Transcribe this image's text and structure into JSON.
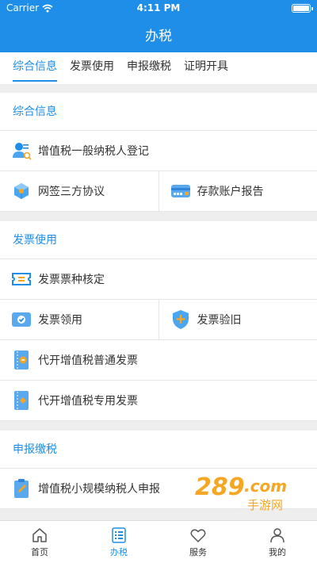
{
  "status_bar": {
    "carrier": "Carrier",
    "time": "4:11 PM"
  },
  "nav": {
    "title": "办税"
  },
  "tabs": [
    {
      "label": "综合信息",
      "active": true
    },
    {
      "label": "发票使用",
      "active": false
    },
    {
      "label": "申报缴税",
      "active": false
    },
    {
      "label": "证明开具",
      "active": false
    }
  ],
  "sections": {
    "general": {
      "title": "综合信息",
      "items": [
        {
          "label": "增值税一般纳税人登记",
          "icon": "user-register-icon"
        },
        {
          "label": "网签三方协议",
          "icon": "cube-agreement-icon"
        },
        {
          "label": "存款账户报告",
          "icon": "bank-card-icon"
        }
      ]
    },
    "invoice": {
      "title": "发票使用",
      "items": [
        {
          "label": "发票票种核定",
          "icon": "ticket-icon"
        },
        {
          "label": "发票领用",
          "icon": "check-envelope-icon"
        },
        {
          "label": "发票验旧",
          "icon": "shield-plus-icon"
        },
        {
          "label": "代开增值税普通发票",
          "icon": "invoice-normal-icon"
        },
        {
          "label": "代开增值税专用发票",
          "icon": "invoice-special-icon"
        }
      ]
    },
    "declare": {
      "title": "申报缴税",
      "items": [
        {
          "label": "增值税小规模纳税人申报",
          "icon": "clipboard-edit-icon"
        }
      ]
    }
  },
  "tabbar": [
    {
      "label": "首页",
      "icon": "home-icon",
      "active": false
    },
    {
      "label": "办税",
      "icon": "list-icon",
      "active": true
    },
    {
      "label": "服务",
      "icon": "heart-icon",
      "active": false
    },
    {
      "label": "我的",
      "icon": "person-icon",
      "active": false
    }
  ],
  "watermark": {
    "text": "289.com 手游网"
  },
  "colors": {
    "primary": "#1f8ee8",
    "background": "#eeeeee",
    "orange": "#f5a623"
  }
}
